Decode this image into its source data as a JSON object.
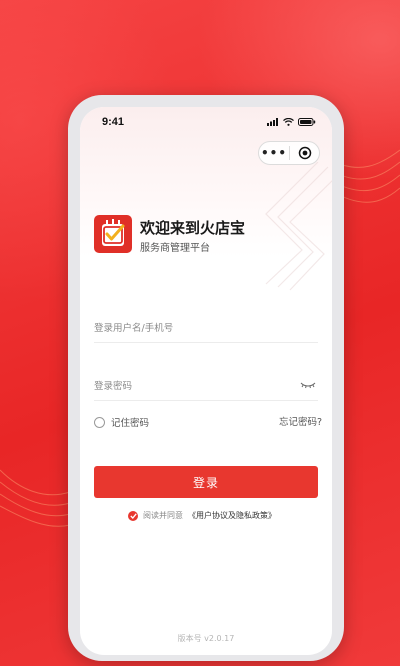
{
  "status_bar": {
    "time": "9:41"
  },
  "capsule": {
    "more_label": "•••"
  },
  "brand": {
    "title": "欢迎来到火店宝",
    "subtitle": "服务商管理平台"
  },
  "form": {
    "username_placeholder": "登录用户名/手机号",
    "password_placeholder": "登录密码",
    "remember_label": "记住密码",
    "forgot_label": "忘记密码?",
    "login_label": "登录"
  },
  "agreement": {
    "prefix": "阅读并同意",
    "link": "《用户协议及隐私政策》"
  },
  "footer": {
    "version": "版本号 v2.0.17"
  },
  "colors": {
    "brand_red": "#e8372f",
    "background_red": "#ee2e2e"
  },
  "icons": [
    "signal-icon",
    "wifi-icon",
    "battery-icon",
    "more-icon",
    "target-icon",
    "logo-icon",
    "eye-closed-icon",
    "radio-icon",
    "check-icon"
  ]
}
